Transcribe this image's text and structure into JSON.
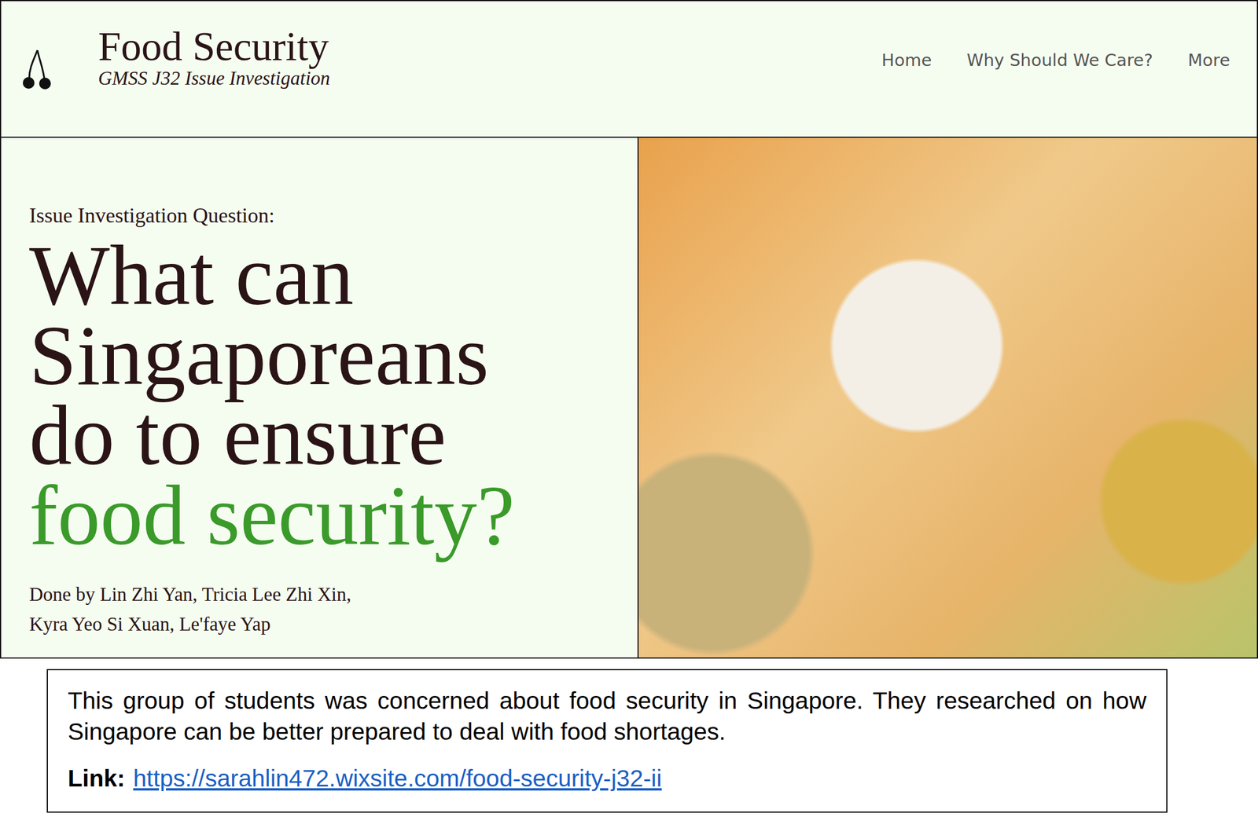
{
  "site": {
    "title": "Food Security",
    "subtitle": "GMSS J32 Issue Investigation"
  },
  "nav": [
    {
      "label": "Home"
    },
    {
      "label": "Why Should We Care?"
    },
    {
      "label": "More"
    }
  ],
  "hero": {
    "eyebrow": "Issue Investigation Question:",
    "question_lines": [
      {
        "text": "What can",
        "highlight": false
      },
      {
        "text": "Singaporeans",
        "highlight": false
      },
      {
        "text": "do to ensure",
        "highlight": false
      },
      {
        "text": "food security?",
        "highlight": true
      }
    ],
    "authors": [
      "Done by Lin Zhi Yan, Tricia Lee Zhi Xin,",
      "Kyra Yeo Si Xuan, Le'faye Yap"
    ]
  },
  "caption": {
    "text": "This group of students was concerned about food security in Singapore. They researched on how Singapore can be better prepared to deal with food shortages.",
    "link_label": "Link:",
    "link": "https://sarahlin472.wixsite.com/food-security-j32-ii"
  }
}
